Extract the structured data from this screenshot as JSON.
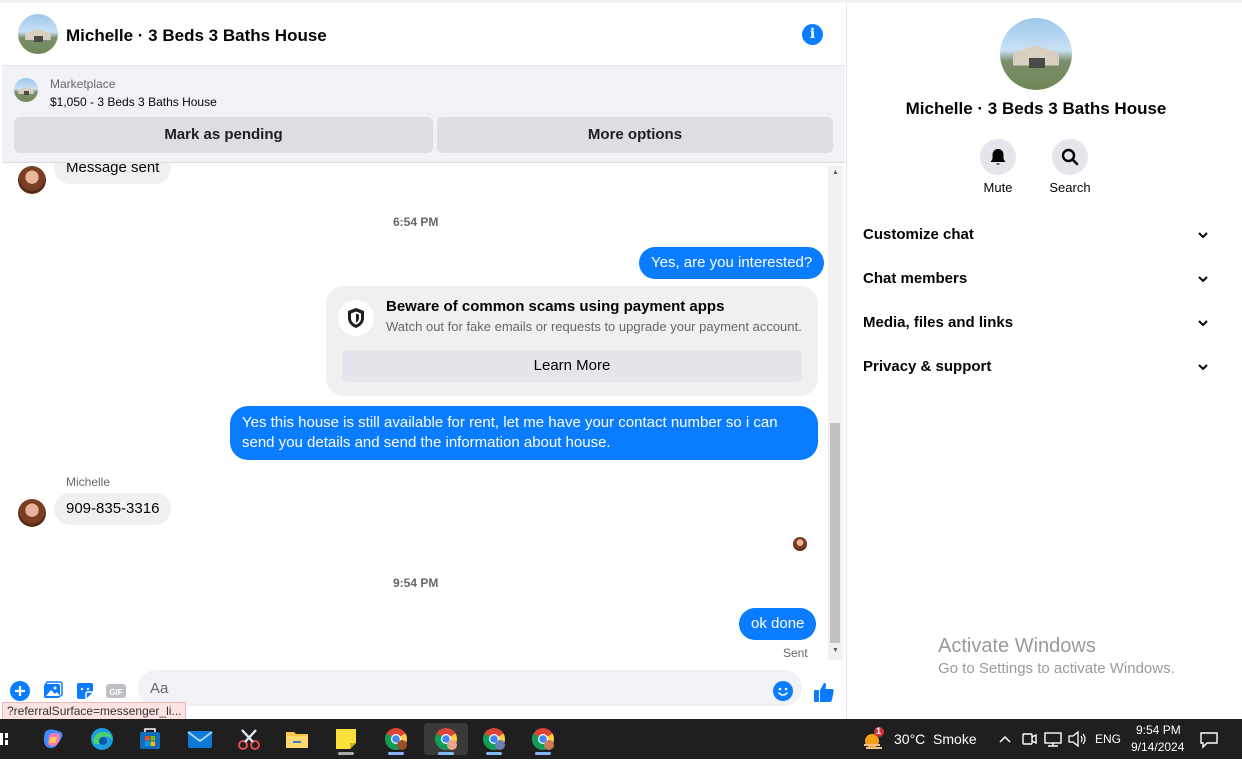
{
  "header": {
    "title": "Michelle · 3 Beds 3 Baths House"
  },
  "marketplace": {
    "label": "Marketplace",
    "listing": "$1,050 - 3 Beds 3 Baths House",
    "pending_button": "Mark as pending",
    "more_button": "More options"
  },
  "messages": {
    "msg_sent": "Message sent",
    "time1": "6:54 PM",
    "out1": "Yes, are you interested?",
    "scam_title": "Beware of common scams using payment apps",
    "scam_sub": "Watch out for fake emails or requests to upgrade your payment account.",
    "learn_more": "Learn More",
    "out2_line1": "Yes this house is still available for rent, let me have your contact number so i can",
    "out2_line2": "send you details and send the information about house.",
    "sender": "Michelle",
    "in_phone": "909-835-3316",
    "time2": "9:54 PM",
    "out3": "ok done",
    "sent": "Sent"
  },
  "composer": {
    "placeholder": "Aa",
    "gif_label": "GIF",
    "status_url": "?referralSurface=messenger_li..."
  },
  "details": {
    "name": "Michelle · 3 Beds 3 Baths House",
    "mute": "Mute",
    "search": "Search",
    "sections": [
      "Customize chat",
      "Chat members",
      "Media, files and links",
      "Privacy & support"
    ]
  },
  "watermark": {
    "line1": "Activate Windows",
    "line2": "Go to Settings to activate Windows."
  },
  "taskbar": {
    "weather": "30°C  Smoke",
    "weather_badge": "1",
    "lang": "ENG",
    "time": "9:54 PM",
    "date": "9/14/2024"
  },
  "colors": {
    "accent": "#0a7cff",
    "bubble_in": "#f0f0f0",
    "taskbar": "#1f1f1f"
  }
}
